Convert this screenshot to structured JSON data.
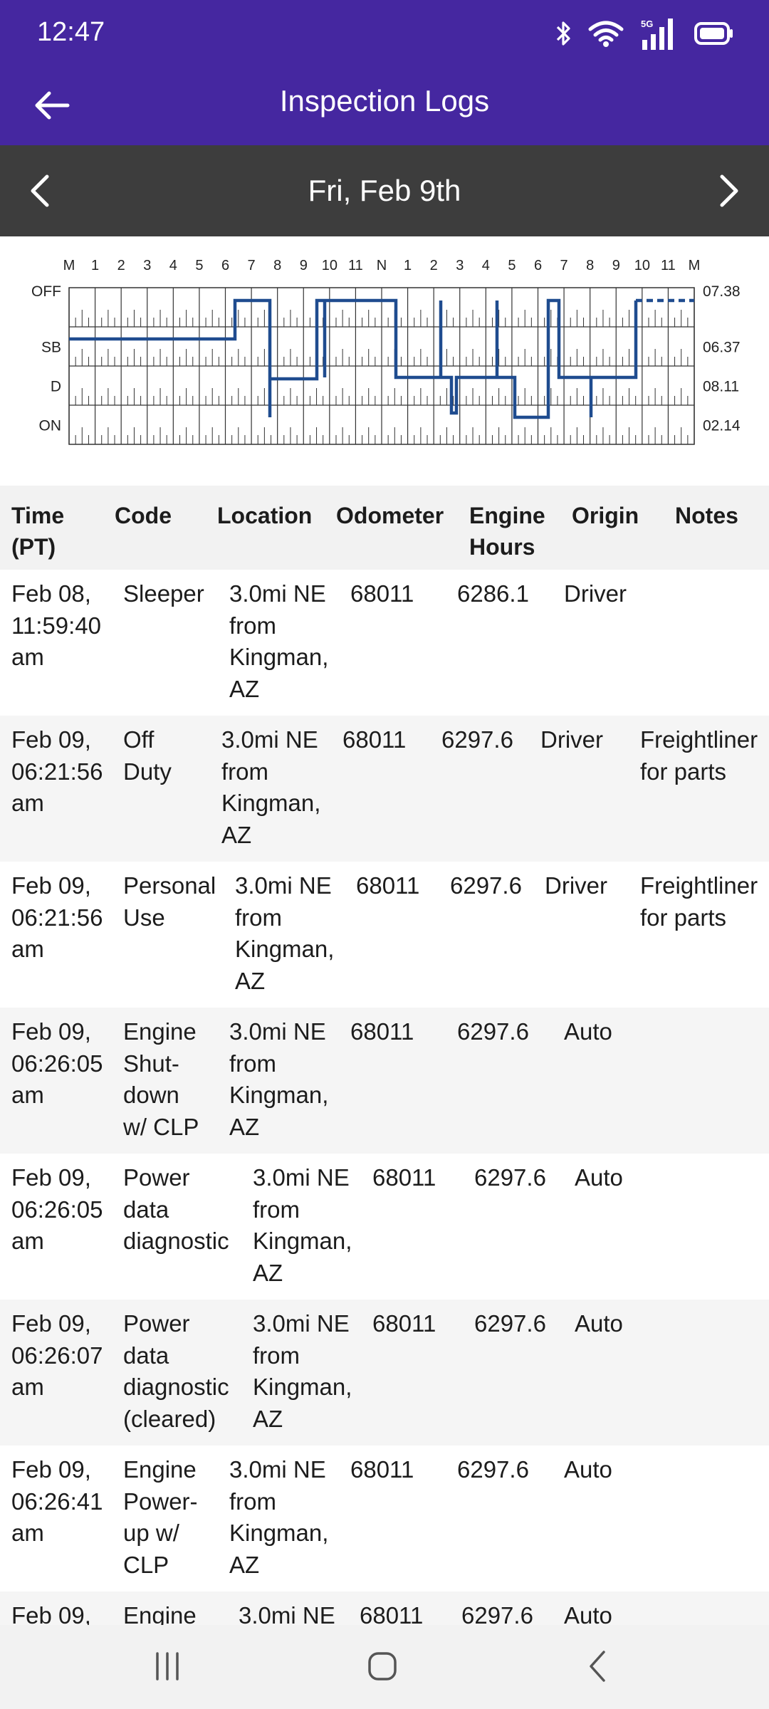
{
  "status": {
    "time": "12:47",
    "network": "5G",
    "icons": [
      "bluetooth-icon",
      "wifi-icon",
      "signal-icon",
      "battery-icon"
    ]
  },
  "app_bar": {
    "title": "Inspection Logs",
    "back_icon": "arrow-left-icon"
  },
  "date_nav": {
    "date": "Fri, Feb 9th",
    "prev_icon": "chevron-left-icon",
    "next_icon": "chevron-right-icon"
  },
  "graph": {
    "hour_labels": [
      "M",
      "1",
      "2",
      "3",
      "4",
      "5",
      "6",
      "7",
      "8",
      "9",
      "10",
      "11",
      "N",
      "1",
      "2",
      "3",
      "4",
      "5",
      "6",
      "7",
      "8",
      "9",
      "10",
      "11",
      "M"
    ],
    "status_labels": [
      "OFF",
      "SB",
      "D",
      "ON"
    ],
    "totals": [
      "07.38",
      "06.37",
      "08.11",
      "02.14"
    ],
    "line_color": "#1f4c8f"
  },
  "table": {
    "headers": [
      "Time\n(PT)",
      "Code",
      "Location",
      "Odometer",
      "Engine\nHours",
      "Origin",
      "Notes"
    ],
    "rows": [
      {
        "time": "Feb 08,\n11:59:40\nam",
        "code": "Sleeper",
        "location": "3.0mi NE\nfrom\nKingman,\nAZ",
        "odometer": "68011",
        "engine_hours": "6286.1",
        "origin": "Driver",
        "notes": ""
      },
      {
        "time": "Feb 09,\n06:21:56\nam",
        "code": "Off\nDuty",
        "location": "3.0mi NE\nfrom\nKingman,\nAZ",
        "odometer": "68011",
        "engine_hours": "6297.6",
        "origin": "Driver",
        "notes": "Freightliner\nfor parts"
      },
      {
        "time": "Feb 09,\n06:21:56\nam",
        "code": "Personal\nUse",
        "location": "3.0mi NE\nfrom\nKingman,\nAZ",
        "odometer": "68011",
        "engine_hours": "6297.6",
        "origin": "Driver",
        "notes": "Freightliner\nfor parts"
      },
      {
        "time": "Feb 09,\n06:26:05\nam",
        "code": "Engine\nShut-\ndown\nw/ CLP",
        "location": "3.0mi NE\nfrom\nKingman,\nAZ",
        "odometer": "68011",
        "engine_hours": "6297.6",
        "origin": "Auto",
        "notes": ""
      },
      {
        "time": "Feb 09,\n06:26:05\nam",
        "code": "Power\ndata\ndiagnostic",
        "location": "3.0mi NE\nfrom\nKingman,\nAZ",
        "odometer": "68011",
        "engine_hours": "6297.6",
        "origin": "Auto",
        "notes": ""
      },
      {
        "time": "Feb 09,\n06:26:07\nam",
        "code": "Power\ndata\ndiagnostic\n(cleared)",
        "location": "3.0mi NE\nfrom\nKingman,\nAZ",
        "odometer": "68011",
        "engine_hours": "6297.6",
        "origin": "Auto",
        "notes": ""
      },
      {
        "time": "Feb 09,\n06:26:41\nam",
        "code": "Engine\nPower-\nup w/\nCLP",
        "location": "3.0mi NE\nfrom\nKingman,\nAZ",
        "odometer": "68011",
        "engine_hours": "6297.6",
        "origin": "Auto",
        "notes": ""
      },
      {
        "time": "Feb 09,",
        "code": "Engine",
        "location": "3.0mi NE",
        "odometer": "68011",
        "engine_hours": "6297.6",
        "origin": "Auto",
        "notes": ""
      }
    ]
  },
  "nav_bar": {
    "icons": [
      "recent-apps-icon",
      "home-icon",
      "back-icon"
    ]
  }
}
